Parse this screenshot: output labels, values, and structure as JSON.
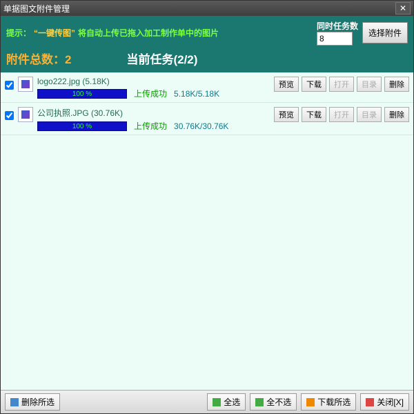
{
  "window": {
    "title": "单据图文附件管理"
  },
  "header": {
    "tip_prefix": "提示：",
    "tip_quote": "“一键传图”",
    "tip_suffix": "将自动上传已拖入加工制作单中的图片",
    "concurrent_label": "同时任务数",
    "concurrent_value": "8",
    "select_attachment": "选择附件",
    "total_label": "附件总数：2",
    "current_task": "当前任务(2/2)"
  },
  "items": [
    {
      "name": "logo222.jpg (5.18K)",
      "progress": "100 %",
      "status": "上传成功",
      "size": "5.18K/5.18K"
    },
    {
      "name": "公司执照.JPG (30.76K)",
      "progress": "100 %",
      "status": "上传成功",
      "size": "30.76K/30.76K"
    }
  ],
  "buttons": {
    "preview": "预览",
    "download": "下载",
    "open": "打开",
    "folder": "目录",
    "delete": "删除"
  },
  "footer": {
    "delete_selected": "删除所选",
    "select_all": "全选",
    "deselect_all": "全不选",
    "download_selected": "下载所选",
    "close": "关闭[X]"
  }
}
